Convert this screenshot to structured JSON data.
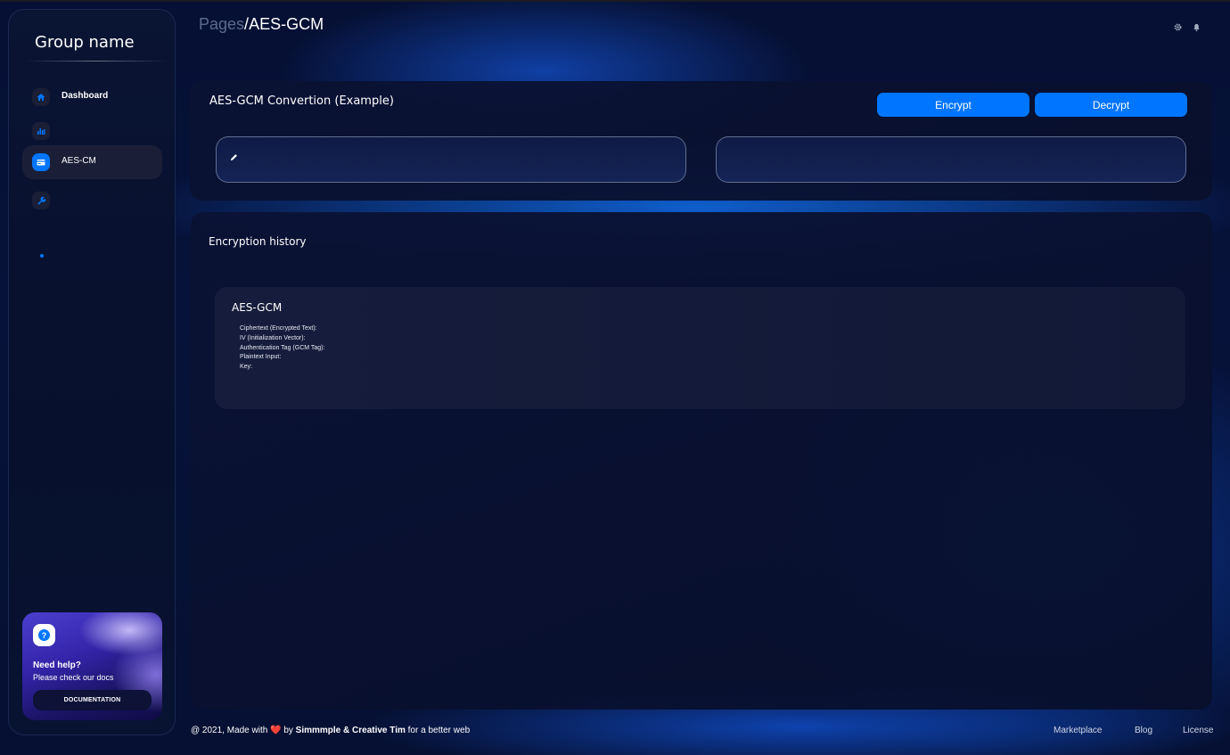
{
  "sidebar": {
    "brand": "Group name",
    "items": [
      {
        "label": "Dashboard",
        "icon": "home-icon",
        "active": false
      },
      {
        "label": "",
        "icon": "chart-icon",
        "active": false
      },
      {
        "label": "AES-CM",
        "icon": "credit-card-icon",
        "active": true
      },
      {
        "label": "",
        "icon": "wrench-icon",
        "active": false
      }
    ],
    "help": {
      "icon": "question-icon",
      "title": "Need help?",
      "subtitle": "Please check our docs",
      "button": "DOCUMENTATION"
    }
  },
  "header": {
    "breadcrumb_parent": "Pages",
    "breadcrumb_separator": "/",
    "breadcrumb_current": "AES-GCM",
    "icons": [
      "gear-icon",
      "bell-icon"
    ]
  },
  "converter": {
    "title": "AES-GCM Convertion (Example)",
    "encrypt_label": "Encrypt",
    "decrypt_label": "Decrypt",
    "input_value": "",
    "output_value": ""
  },
  "history": {
    "title": "Encryption history",
    "entries": [
      {
        "title": "AES-GCM",
        "fields": [
          "Ciphertext (Encrypted Text):",
          "IV (Initialization Vector):",
          "Authentication Tag (GCM Tag):",
          "Plaintext Input:",
          "Key:"
        ]
      }
    ]
  },
  "footer": {
    "prefix": "@ 2021, Made with",
    "heart": "❤️",
    "by": "by",
    "authors": "Simmmple & Creative Tim",
    "suffix": "for a better web",
    "links": [
      "Marketplace",
      "Blog",
      "License"
    ]
  },
  "colors": {
    "accent": "#0075ff",
    "background": "#061034",
    "card": "#0a1234",
    "active_nav": "#1a1f37"
  }
}
